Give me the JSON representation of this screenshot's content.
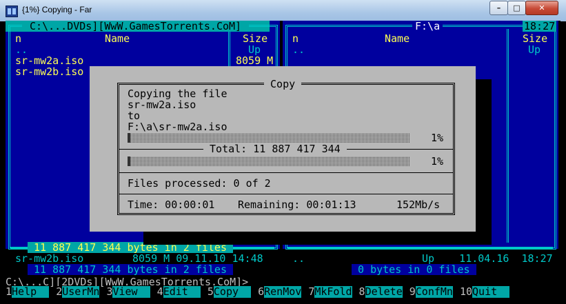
{
  "window": {
    "title": "{1%} Copying - Far",
    "min_glyph": "–",
    "max_glyph": "□",
    "close_glyph": "✕"
  },
  "left_panel": {
    "path": " C:\\...DVDs][WwW.GamesTorrents.CoM] ",
    "col_name_hdr_n": "n",
    "col_name_hdr": "Name",
    "col_size_hdr": "Size",
    "rows": [
      {
        "name": "..",
        "size": "Up"
      },
      {
        "name": "sr-mw2a.iso",
        "size": "8059 M"
      },
      {
        "name": "sr-mw2b.iso",
        "size": ""
      }
    ],
    "selected_summary": " 11 887 417 344 bytes in 2 files ",
    "status_name": "sr-mw2b.iso",
    "status_info": "8059 M 09.11.10 14:48",
    "total_summary": " 11 887 417 344 bytes in 2 files "
  },
  "right_panel": {
    "path": "F:\\a",
    "clock": "18:27",
    "col_name_hdr_n": "n",
    "col_name_hdr": "Name",
    "col_size_hdr": "Size",
    "rows": [
      {
        "name": "..",
        "size": "Up"
      }
    ],
    "status_name": "..",
    "status_info": "Up    11.04.16  18:27",
    "total_summary": " 0 bytes in 0 files "
  },
  "dialog": {
    "title": " Copy ",
    "line1": "Copying the file",
    "line2": "sr-mw2a.iso",
    "line3": "to",
    "line4": "F:\\a\\sr-mw2a.iso",
    "file_progress_pct": 1,
    "file_pct_label": "1%",
    "total_label": " Total: 11 887 417 344 ",
    "total_progress_pct": 1,
    "total_pct_label": "1%",
    "files_processed": "Files processed: 0 of 2",
    "time_label": "Time: 00:00:01",
    "remaining_label": "Remaining: 00:01:13",
    "speed_label": "152Mb/s"
  },
  "command_line": "C:\\...C][2DVDs][WwW.GamesTorrents.CoM]>",
  "keybar": [
    {
      "num": "1",
      "label": "Help  "
    },
    {
      "num": "2",
      "label": "UserMn"
    },
    {
      "num": "3",
      "label": "View  "
    },
    {
      "num": "4",
      "label": "Edit  "
    },
    {
      "num": "5",
      "label": "Copy  "
    },
    {
      "num": "6",
      "label": "RenMov"
    },
    {
      "num": "7",
      "label": "MkFold"
    },
    {
      "num": "8",
      "label": "Delete"
    },
    {
      "num": "9",
      "label": "ConfMn"
    },
    {
      "num": "10",
      "label": "Quit  "
    }
  ],
  "colors": {
    "panel_bg": "#00009e",
    "panel_frame": "#00c8c8",
    "file_text": "#ffff54",
    "selection_bg": "#00a6a6",
    "dialog_bg": "#b8b8b8"
  }
}
